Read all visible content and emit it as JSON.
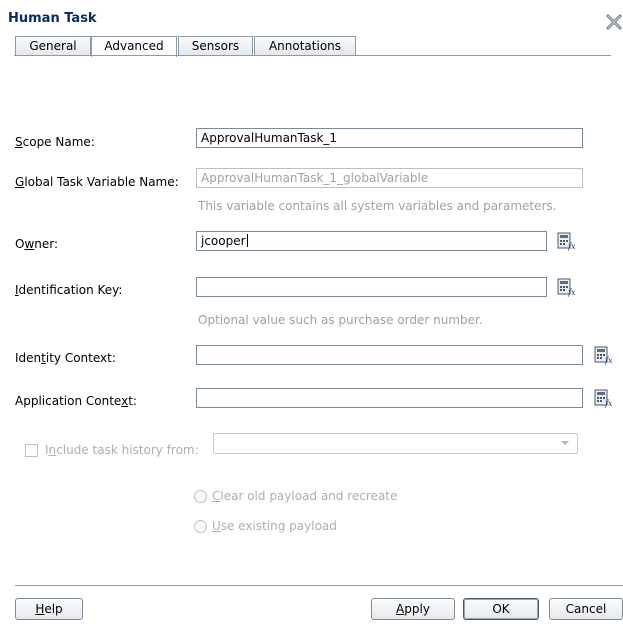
{
  "dialog": {
    "title": "Human Task"
  },
  "tabs": [
    {
      "label": "General"
    },
    {
      "label": "Advanced"
    },
    {
      "label": "Sensors"
    },
    {
      "label": "Annotations"
    }
  ],
  "form": {
    "scope_name": {
      "label_pre": "",
      "label_key": "S",
      "label_post": "cope Name:",
      "value": "ApprovalHumanTask_1"
    },
    "global_var": {
      "label_pre": "",
      "label_key": "G",
      "label_post": "lobal Task Variable Name:",
      "value": "ApprovalHumanTask_1_globalVariable",
      "hint": "This variable contains all system variables and parameters."
    },
    "owner": {
      "label_pre": "O",
      "label_key": "w",
      "label_post": "ner:",
      "value": "jcooper"
    },
    "ident_key": {
      "label_pre": "",
      "label_key": "I",
      "label_post": "dentification Key:",
      "value": "",
      "hint": "Optional value such as purchase order number."
    },
    "ident_ctx": {
      "label_pre": "Iden",
      "label_key": "t",
      "label_post": "ity Context:",
      "value": ""
    },
    "app_ctx": {
      "label_pre": "Application Conte",
      "label_key": "x",
      "label_post": "t:",
      "value": ""
    },
    "history": {
      "label_pre": "I",
      "label_key": "n",
      "label_post": "clude task history from:",
      "checked": false,
      "selected": ""
    },
    "radio_clear": {
      "label_pre": "",
      "label_key": "C",
      "label_post": "lear old payload and recreate"
    },
    "radio_use": {
      "label_pre": "",
      "label_key": "U",
      "label_post": "se existing payload"
    }
  },
  "buttons": {
    "help": {
      "pre": "",
      "key": "H",
      "post": "elp"
    },
    "apply": {
      "pre": "",
      "key": "A",
      "post": "pply"
    },
    "ok": {
      "label": "OK"
    },
    "cancel": {
      "label": "Cancel"
    }
  },
  "colors": {
    "title": "#0b2a6b",
    "disabled_text": "#9aa3ab",
    "border": "#7a8a99"
  },
  "icons": {
    "close": "close-icon",
    "expression_builder": "expression-builder-icon"
  }
}
